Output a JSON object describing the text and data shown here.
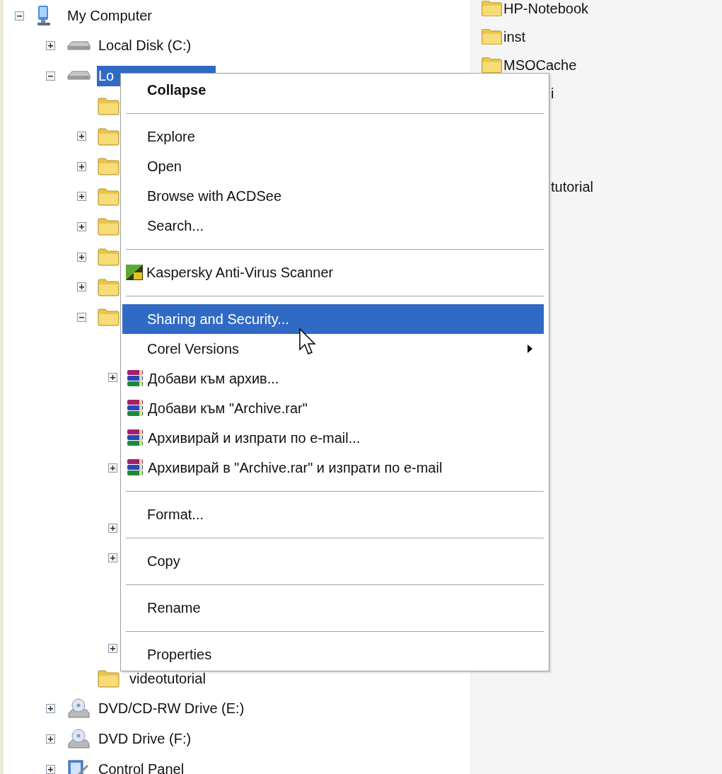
{
  "tree": [
    {
      "label": "My Computer",
      "kind": "computer",
      "expanded": true,
      "selected": false,
      "children": [
        {
          "label": "Local Disk (C:)",
          "kind": "drive",
          "expanded": false,
          "selected": false
        },
        {
          "label": "Lo",
          "kind": "drive",
          "expanded": true,
          "selected": true,
          "children": [
            {
              "kind": "folder"
            },
            {
              "kind": "folder",
              "expanded": false
            },
            {
              "kind": "folder",
              "expanded": false
            },
            {
              "kind": "folder",
              "expanded": false
            },
            {
              "kind": "folder",
              "expanded": false
            },
            {
              "kind": "folder",
              "expanded": false
            },
            {
              "kind": "folder",
              "expanded": false
            },
            {
              "kind": "folder",
              "expanded": true,
              "children": [
                {
                  "kind": "hidden"
                },
                {
                  "kind": "hidden",
                  "expanded": false
                },
                {
                  "kind": "hidden"
                },
                {
                  "kind": "hidden"
                },
                {
                  "kind": "hidden",
                  "expanded": false
                },
                {
                  "kind": "hidden"
                },
                {
                  "kind": "hidden",
                  "expanded": false
                },
                {
                  "kind": "hidden",
                  "expanded": false
                },
                {
                  "kind": "hidden"
                },
                {
                  "kind": "hidden"
                },
                {
                  "kind": "hidden",
                  "expanded": false
                }
              ]
            },
            {
              "label": "videotutorial",
              "kind": "folder",
              "selected": false
            }
          ]
        },
        {
          "label": "DVD/CD-RW Drive (E:)",
          "kind": "disc",
          "expanded": false,
          "selected": false
        },
        {
          "label": "DVD Drive (F:)",
          "kind": "disc",
          "expanded": false,
          "selected": false
        },
        {
          "label": "Control Panel",
          "kind": "control",
          "expanded": false,
          "selected": false
        }
      ]
    }
  ],
  "files": [
    {
      "kind": "full",
      "label": "HP-Notebook"
    },
    {
      "kind": "full",
      "label": "inst"
    },
    {
      "kind": "full",
      "label": "MSOCache"
    },
    {
      "kind": "partial",
      "label": "i"
    },
    {
      "kind": "hidden"
    },
    {
      "kind": "hidden"
    },
    {
      "kind": "partial",
      "label": "tutorial"
    }
  ],
  "context_menu": [
    {
      "kind": "plain",
      "label": "Collapse",
      "bold": true,
      "selected": false
    },
    {
      "kind": "separator"
    },
    {
      "kind": "plain",
      "label": "Explore",
      "selected": false
    },
    {
      "kind": "plain",
      "label": "Open",
      "selected": false
    },
    {
      "kind": "plain",
      "label": "Browse with ACDSee",
      "selected": false
    },
    {
      "kind": "plain",
      "label": "Search...",
      "selected": false
    },
    {
      "kind": "separator"
    },
    {
      "kind": "antivirus",
      "label": "Kaspersky Anti-Virus Scanner",
      "selected": false
    },
    {
      "kind": "separator"
    },
    {
      "kind": "plain",
      "label": "Sharing and Security...",
      "selected": true
    },
    {
      "kind": "plain",
      "label": "Corel Versions",
      "submenu": true,
      "selected": false
    },
    {
      "kind": "archive",
      "label": "Добави към архив...",
      "selected": false
    },
    {
      "kind": "archive",
      "label": "Добави към \"Archive.rar\"",
      "selected": false
    },
    {
      "kind": "archive",
      "label": "Архивирай и изпрати по e-mail...",
      "selected": false
    },
    {
      "kind": "archive",
      "label": "Архивирай в \"Archive.rar\" и изпрати по e-mail",
      "selected": false
    },
    {
      "kind": "separator"
    },
    {
      "kind": "plain",
      "label": "Format...",
      "selected": false
    },
    {
      "kind": "separator"
    },
    {
      "kind": "plain",
      "label": "Copy",
      "selected": false
    },
    {
      "kind": "separator"
    },
    {
      "kind": "plain",
      "label": "Rename",
      "selected": false
    },
    {
      "kind": "separator"
    },
    {
      "kind": "plain",
      "label": "Properties",
      "selected": false
    }
  ]
}
